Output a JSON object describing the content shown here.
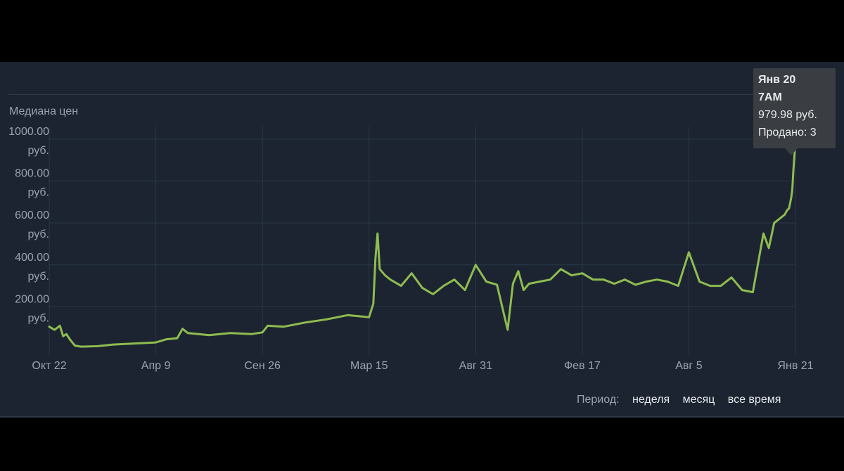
{
  "chart_data": {
    "type": "line",
    "ylabel": "Медиана цен",
    "currency": "руб.",
    "y_ticks": [
      {
        "value": 1000,
        "label": "1000.00",
        "unit": "руб."
      },
      {
        "value": 800,
        "label": "800.00",
        "unit": "руб."
      },
      {
        "value": 600,
        "label": "600.00",
        "unit": "руб."
      },
      {
        "value": 400,
        "label": "400.00",
        "unit": "руб."
      },
      {
        "value": 200,
        "label": "200.00",
        "unit": "руб."
      }
    ],
    "ylim": [
      -30,
      1060
    ],
    "x_ticks": [
      "Окт 22",
      "Апр 9",
      "Сен 26",
      "Мар 15",
      "Авг 31",
      "Фев 17",
      "Авг 5",
      "Янв 21"
    ],
    "x_tick_index": [
      0,
      1,
      2,
      3,
      4,
      5,
      6,
      7
    ],
    "xlim": [
      0,
      7.05
    ],
    "grid": true,
    "line_color": "#8fbc4f",
    "series": [
      {
        "x": [
          0,
          0.05,
          0.1,
          0.13,
          0.16,
          0.2,
          0.24,
          0.3,
          0.45,
          0.6,
          0.8,
          1.0,
          1.1,
          1.2,
          1.25,
          1.3,
          1.5,
          1.7,
          1.9,
          2.0,
          2.05,
          2.2,
          2.4,
          2.6,
          2.7,
          2.8,
          2.9,
          3.0,
          3.04,
          3.06,
          3.08,
          3.1,
          3.15,
          3.2,
          3.3,
          3.4,
          3.5,
          3.6,
          3.7,
          3.8,
          3.9,
          4.0,
          4.1,
          4.2,
          4.3,
          4.35,
          4.4,
          4.45,
          4.5,
          4.6,
          4.7,
          4.8,
          4.9,
          5.0,
          5.1,
          5.2,
          5.3,
          5.4,
          5.5,
          5.6,
          5.7,
          5.8,
          5.9,
          6.0,
          6.1,
          6.2,
          6.3,
          6.4,
          6.5,
          6.6,
          6.7,
          6.75,
          6.8,
          6.85,
          6.9,
          6.92,
          6.94,
          6.96,
          6.97,
          6.98,
          6.99,
          7.0
        ],
        "values": [
          105,
          90,
          110,
          60,
          70,
          40,
          15,
          10,
          12,
          20,
          25,
          30,
          45,
          50,
          95,
          75,
          65,
          75,
          70,
          78,
          110,
          105,
          125,
          140,
          150,
          160,
          155,
          150,
          215,
          430,
          550,
          380,
          350,
          330,
          300,
          360,
          290,
          260,
          300,
          330,
          280,
          400,
          320,
          305,
          90,
          310,
          370,
          280,
          310,
          320,
          330,
          380,
          350,
          360,
          330,
          330,
          310,
          330,
          305,
          320,
          330,
          320,
          300,
          460,
          320,
          300,
          300,
          340,
          280,
          270,
          550,
          480,
          600,
          620,
          640,
          660,
          670,
          720,
          760,
          850,
          920,
          980
        ]
      }
    ]
  },
  "tooltip": {
    "date": "Янв 20",
    "time": "7AM",
    "price": "979.98 руб.",
    "sold": "Продано: 3"
  },
  "period": {
    "label": "Период:",
    "options": [
      "неделя",
      "месяц",
      "все время"
    ]
  }
}
